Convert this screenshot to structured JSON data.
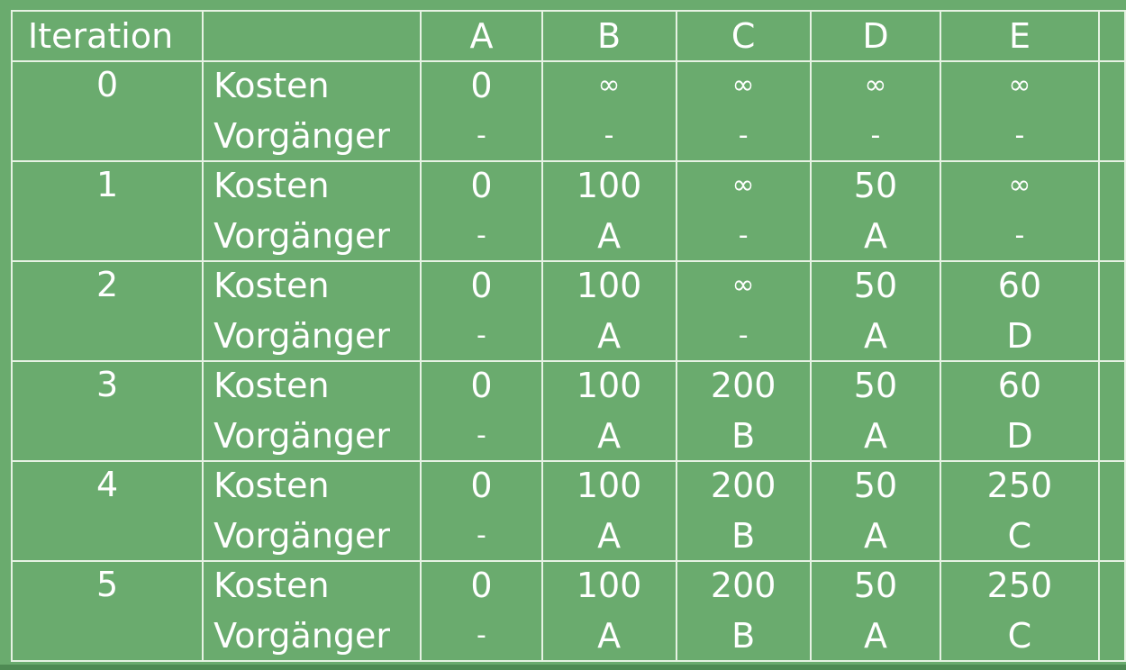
{
  "table": {
    "headers": [
      "Iteration",
      "",
      "A",
      "B",
      "C",
      "D",
      "E"
    ],
    "row_labels": [
      "Kosten",
      "Vorgänger"
    ],
    "rows": [
      {
        "iteration": "0",
        "kosten": [
          "0",
          "∞",
          "∞",
          "∞",
          "∞"
        ],
        "vorgaenger": [
          "-",
          "-",
          "-",
          "-",
          "-"
        ]
      },
      {
        "iteration": "1",
        "kosten": [
          "0",
          "100",
          "∞",
          "50",
          "∞"
        ],
        "vorgaenger": [
          "-",
          "A",
          "-",
          "A",
          "-"
        ]
      },
      {
        "iteration": "2",
        "kosten": [
          "0",
          "100",
          "∞",
          "50",
          "60"
        ],
        "vorgaenger": [
          "-",
          "A",
          "-",
          "A",
          "D"
        ]
      },
      {
        "iteration": "3",
        "kosten": [
          "0",
          "100",
          "200",
          "50",
          "60"
        ],
        "vorgaenger": [
          "-",
          "A",
          "B",
          "A",
          "D"
        ]
      },
      {
        "iteration": "4",
        "kosten": [
          "0",
          "100",
          "200",
          "50",
          "250"
        ],
        "vorgaenger": [
          "-",
          "A",
          "B",
          "A",
          "C"
        ]
      },
      {
        "iteration": "5",
        "kosten": [
          "0",
          "100",
          "200",
          "50",
          "250"
        ],
        "vorgaenger": [
          "-",
          "A",
          "B",
          "A",
          "C"
        ]
      }
    ]
  },
  "colors": {
    "background": "#6aab6e",
    "grid_line": "#e6f2e3",
    "text": "#ffffff"
  }
}
